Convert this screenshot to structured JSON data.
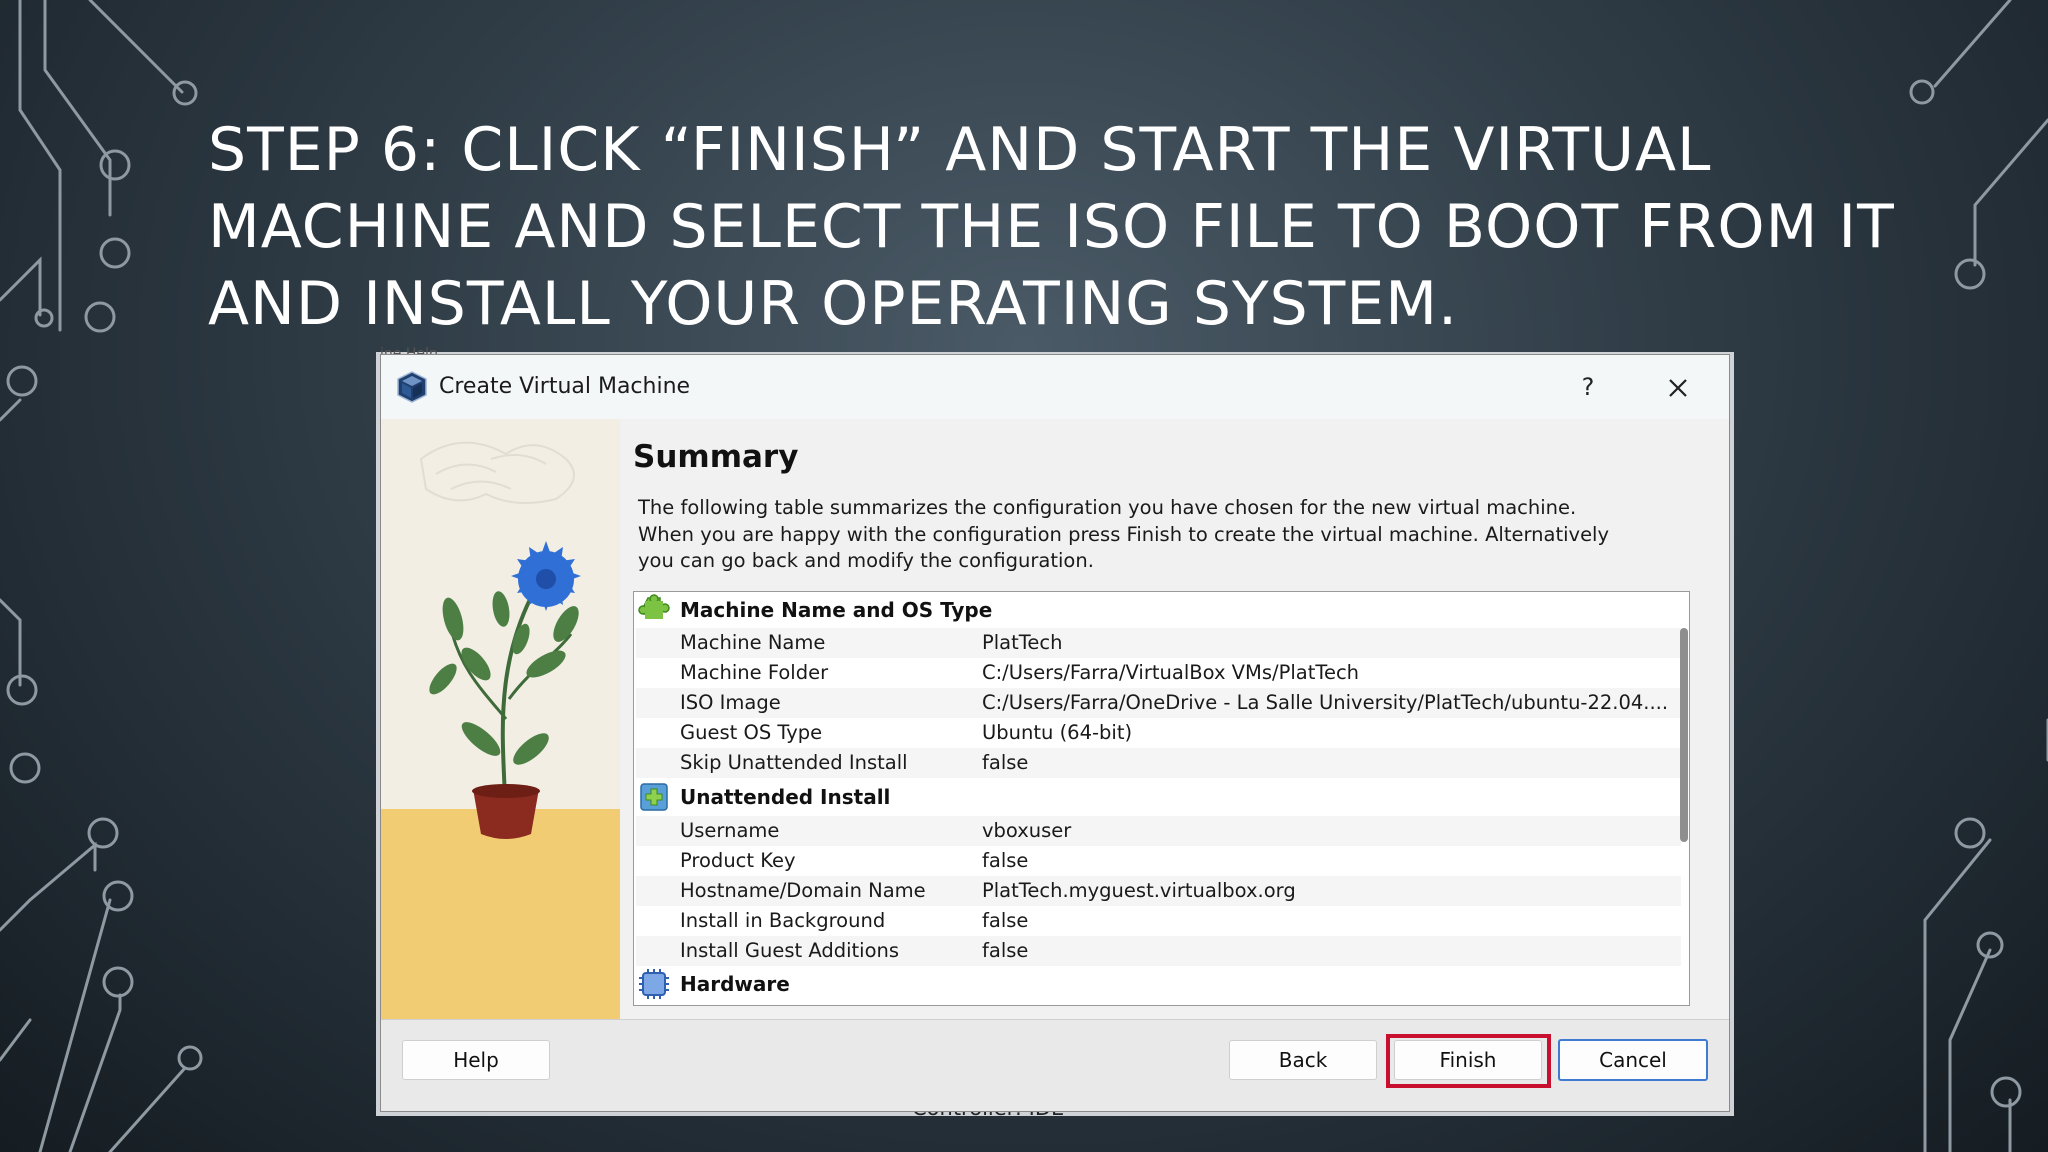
{
  "slide": {
    "title_lines": [
      "STEP 6: CLICK “FINISH” AND START THE VIRTUAL",
      "MACHINE AND SELECT THE ISO FILE TO BOOT FROM IT",
      "AND INSTALL YOUR OPERATING SYSTEM."
    ]
  },
  "background_app": {
    "menu_text": "ine    Help",
    "status_text": "Controller: IDE"
  },
  "dialog": {
    "title": "Create Virtual Machine",
    "help_glyph": "?",
    "heading": "Summary",
    "description_lines": [
      "The following table summarizes the configuration you have chosen for the new virtual machine.",
      "When you are happy with the configuration press Finish to create the virtual machine. Alternatively",
      "you can go back and modify the configuration."
    ],
    "sections": [
      {
        "title": "Machine Name and OS Type",
        "icon": "puzzle-green-icon",
        "rows": [
          {
            "key": "Machine Name",
            "value": "PlatTech"
          },
          {
            "key": "Machine Folder",
            "value": "C:/Users/Farra/VirtualBox VMs/PlatTech"
          },
          {
            "key": "ISO Image",
            "value": "C:/Users/Farra/OneDrive - La Salle University/PlatTech/ubuntu-22.04...."
          },
          {
            "key": "Guest OS Type",
            "value": "Ubuntu (64-bit)"
          },
          {
            "key": "Skip Unattended Install",
            "value": "false"
          }
        ]
      },
      {
        "title": "Unattended Install",
        "icon": "unattended-install-icon",
        "rows": [
          {
            "key": "Username",
            "value": "vboxuser"
          },
          {
            "key": "Product Key",
            "value": "false"
          },
          {
            "key": "Hostname/Domain Name",
            "value": "PlatTech.myguest.virtualbox.org"
          },
          {
            "key": "Install in Background",
            "value": "false"
          },
          {
            "key": "Install Guest Additions",
            "value": "false"
          }
        ]
      },
      {
        "title": "Hardware",
        "icon": "hardware-chip-icon",
        "rows": []
      }
    ],
    "buttons": {
      "help": "Help",
      "back": "Back",
      "finish": "Finish",
      "cancel": "Cancel"
    }
  },
  "colors": {
    "highlight": "#c8102e",
    "cancel_focus": "#3e7bd1"
  }
}
